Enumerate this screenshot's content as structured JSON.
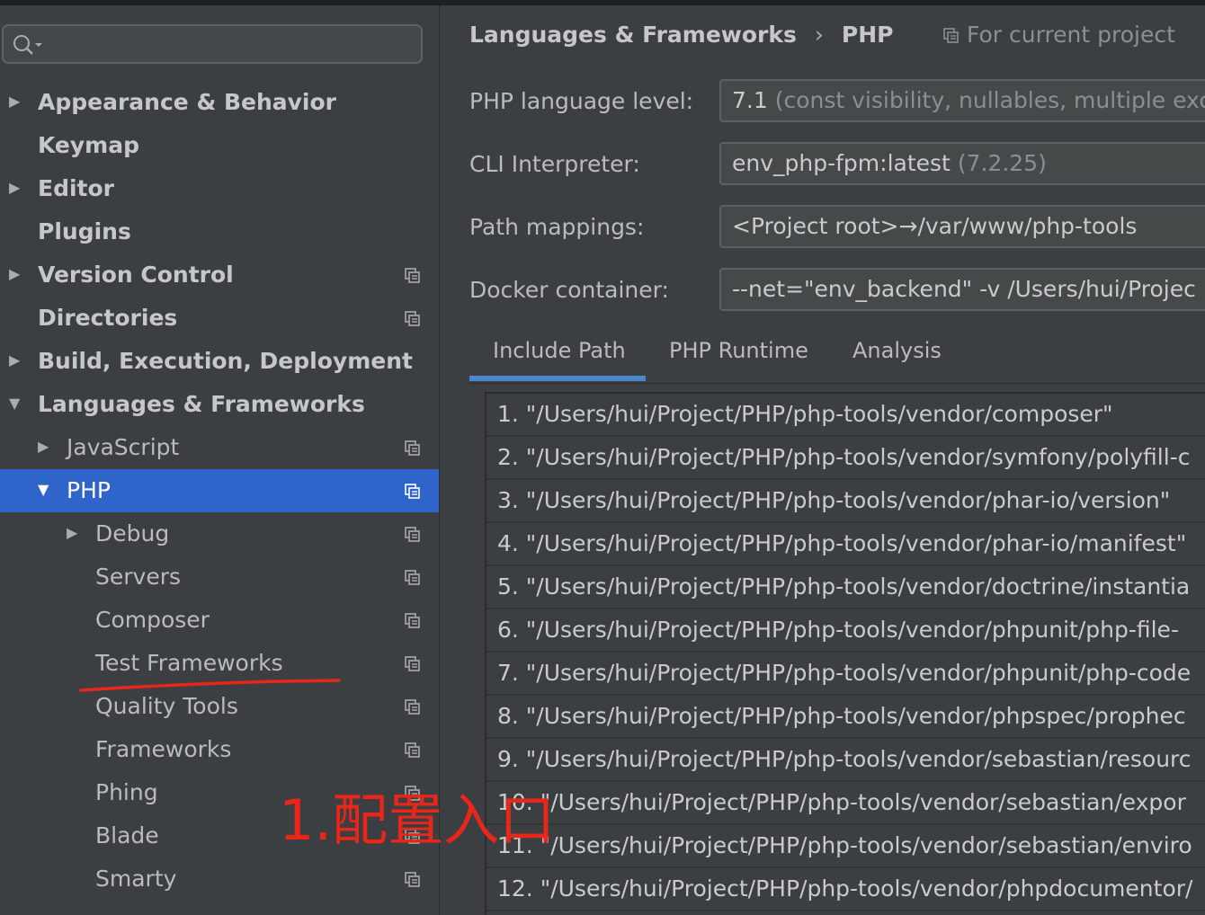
{
  "sidebar": {
    "search": {
      "placeholder": ""
    },
    "items": [
      {
        "label": "Appearance & Behavior",
        "arrow": "▶",
        "bold": true
      },
      {
        "label": "Keymap",
        "arrow": "",
        "bold": true
      },
      {
        "label": "Editor",
        "arrow": "▶",
        "bold": true
      },
      {
        "label": "Plugins",
        "arrow": "",
        "bold": true
      },
      {
        "label": "Version Control",
        "arrow": "▶",
        "bold": true,
        "project_icon": true
      },
      {
        "label": "Directories",
        "arrow": "",
        "bold": true,
        "project_icon": true
      },
      {
        "label": "Build, Execution, Deployment",
        "arrow": "▶",
        "bold": true
      },
      {
        "label": "Languages & Frameworks",
        "arrow": "▼",
        "bold": true
      },
      {
        "label": "JavaScript",
        "arrow": "▶",
        "project_icon": true
      },
      {
        "label": "PHP",
        "arrow": "▼",
        "project_icon": true,
        "selected": true
      },
      {
        "label": "Debug",
        "arrow": "▶",
        "project_icon": true
      },
      {
        "label": "Servers",
        "arrow": "",
        "project_icon": true
      },
      {
        "label": "Composer",
        "arrow": "",
        "project_icon": true
      },
      {
        "label": "Test Frameworks",
        "arrow": "",
        "project_icon": true
      },
      {
        "label": "Quality Tools",
        "arrow": "",
        "project_icon": true
      },
      {
        "label": "Frameworks",
        "arrow": "",
        "project_icon": true
      },
      {
        "label": "Phing",
        "arrow": "",
        "project_icon": true
      },
      {
        "label": "Blade",
        "arrow": "",
        "project_icon": true
      },
      {
        "label": "Smarty",
        "arrow": "",
        "project_icon": true
      }
    ]
  },
  "header": {
    "crumb_parent": "Languages & Frameworks",
    "crumb_separator": "›",
    "crumb_current": "PHP",
    "for_current_project": "For current project"
  },
  "settings": {
    "language_level": {
      "label": "PHP language level:",
      "value": "7.1",
      "hint": "(const visibility, nullables, multiple exc"
    },
    "cli_interpreter": {
      "label": "CLI Interpreter:",
      "value": "env_php-fpm:latest",
      "hint": "(7.2.25)"
    },
    "path_mappings": {
      "label": "Path mappings:",
      "value": "<Project root>→/var/www/php-tools"
    },
    "docker_container": {
      "label": "Docker container:",
      "value": "--net=\"env_backend\" -v /Users/hui/Projec"
    }
  },
  "tabs": [
    {
      "label": "Include Path",
      "active": true
    },
    {
      "label": "PHP Runtime",
      "active": false
    },
    {
      "label": "Analysis",
      "active": false
    }
  ],
  "include_paths": [
    "1. \"/Users/hui/Project/PHP/php-tools/vendor/composer\"",
    "2. \"/Users/hui/Project/PHP/php-tools/vendor/symfony/polyfill-c",
    "3. \"/Users/hui/Project/PHP/php-tools/vendor/phar-io/version\"",
    "4. \"/Users/hui/Project/PHP/php-tools/vendor/phar-io/manifest\"",
    "5. \"/Users/hui/Project/PHP/php-tools/vendor/doctrine/instantia",
    "6. \"/Users/hui/Project/PHP/php-tools/vendor/phpunit/php-file-",
    "7. \"/Users/hui/Project/PHP/php-tools/vendor/phpunit/php-code",
    "8. \"/Users/hui/Project/PHP/php-tools/vendor/phpspec/prophec",
    "9. \"/Users/hui/Project/PHP/php-tools/vendor/sebastian/resourc",
    "10. \"/Users/hui/Project/PHP/php-tools/vendor/sebastian/expor",
    "11. \"/Users/hui/Project/PHP/php-tools/vendor/sebastian/enviro",
    "12. \"/Users/hui/Project/PHP/php-tools/vendor/phpdocumentor/"
  ],
  "annotation": {
    "text": "1.配置入口",
    "color": "#e8261a"
  },
  "colors": {
    "selection": "#2f65ca",
    "background": "#3c3f41",
    "tab_underline": "#4a88c7"
  }
}
